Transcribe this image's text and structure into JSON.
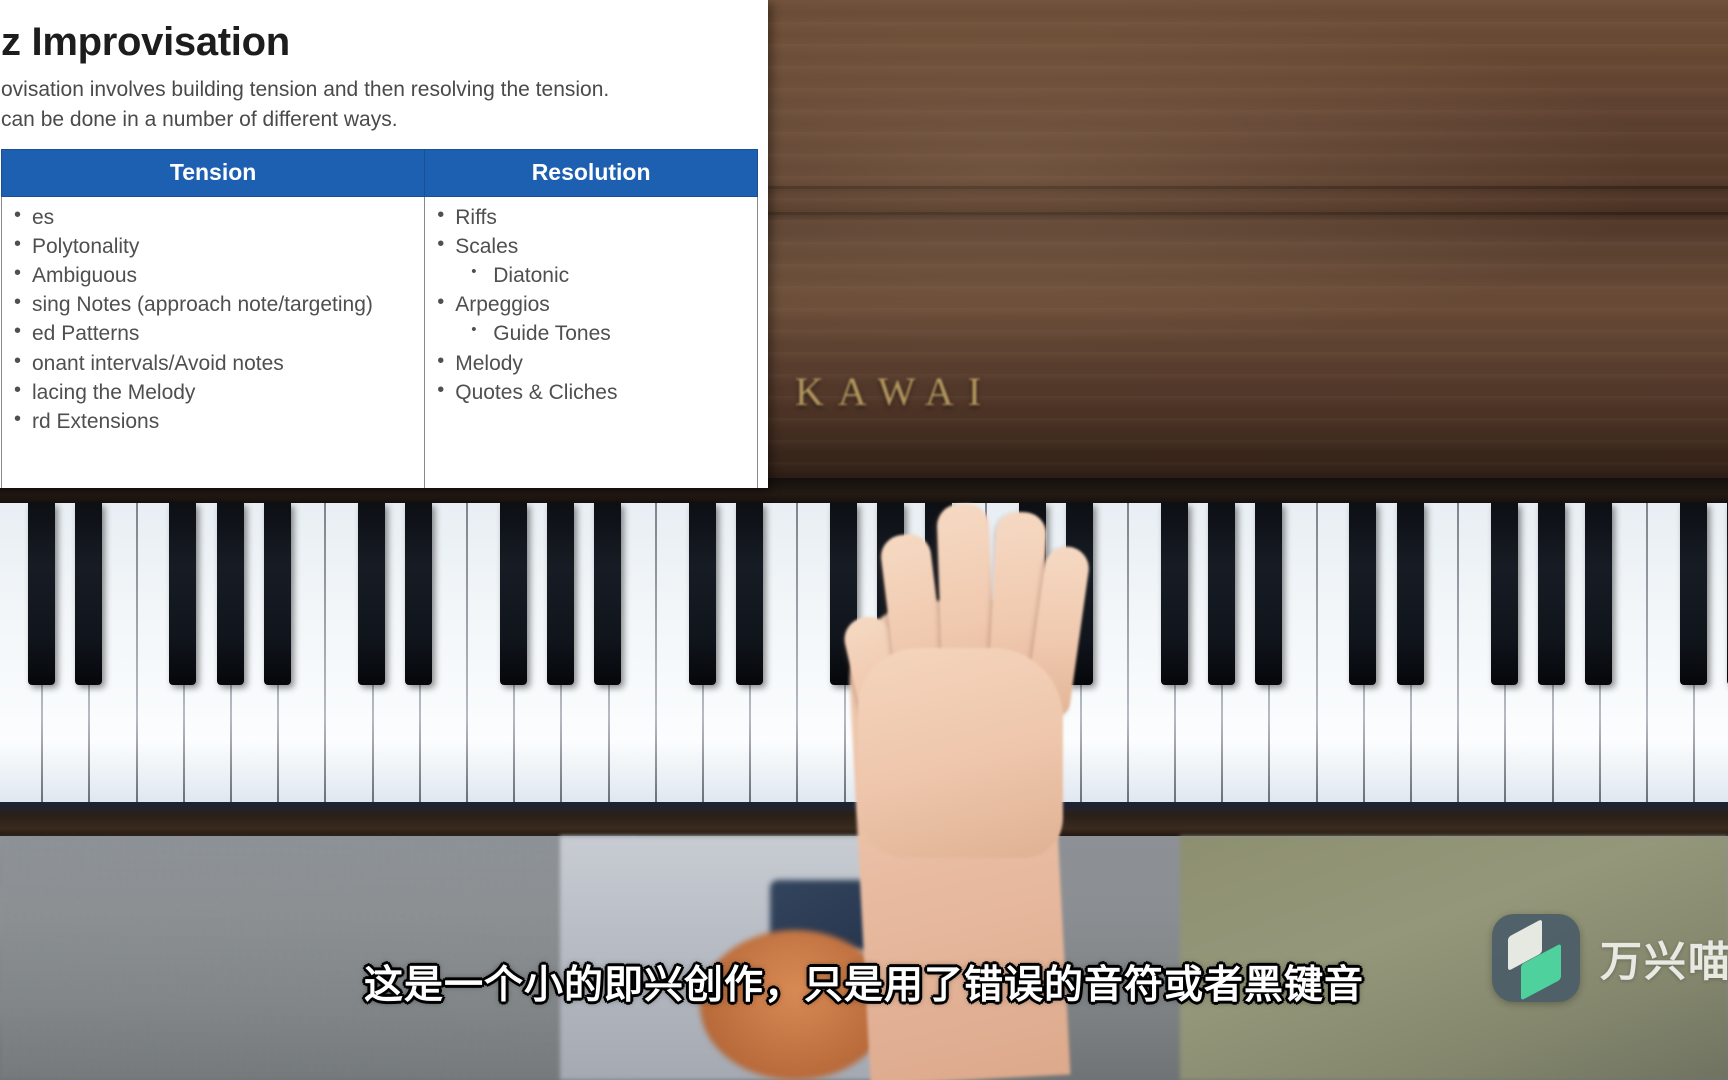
{
  "slide": {
    "title": "z Improvisation",
    "lead_line_1": "ovisation involves building tension and then resolving the tension.",
    "lead_line_2": "can be done in a number of different ways.",
    "table": {
      "headers": [
        "Tension",
        "Resolution"
      ],
      "tension_items": [
        "es",
        "Polytonality",
        "Ambiguous",
        "sing Notes (approach note/targeting)",
        "ed Patterns",
        "onant intervals/Avoid notes",
        "lacing the Melody",
        "rd Extensions"
      ],
      "resolution_items": [
        {
          "text": "Riffs",
          "level": 1
        },
        {
          "text": "Scales",
          "level": 1
        },
        {
          "text": "Diatonic",
          "level": 2
        },
        {
          "text": "Arpeggios",
          "level": 1
        },
        {
          "text": "Guide Tones",
          "level": 2
        },
        {
          "text": "Melody",
          "level": 1
        },
        {
          "text": "Quotes & Cliches",
          "level": 1
        }
      ]
    },
    "header_color": "#1d5fb0",
    "background_color": "#ffffff"
  },
  "video": {
    "piano_brand": "KAWAI",
    "scene": "overhead-piano-keyboard-with-hand"
  },
  "subtitle": {
    "text": "这是一个小的即兴创作，只是用了错误的音符或者黑键音"
  },
  "watermark": {
    "label": "万兴喵",
    "icon_name": "filmora-logo-icon",
    "icon_bg": "#4b5d68",
    "icon_accent": "#49d7a0"
  }
}
